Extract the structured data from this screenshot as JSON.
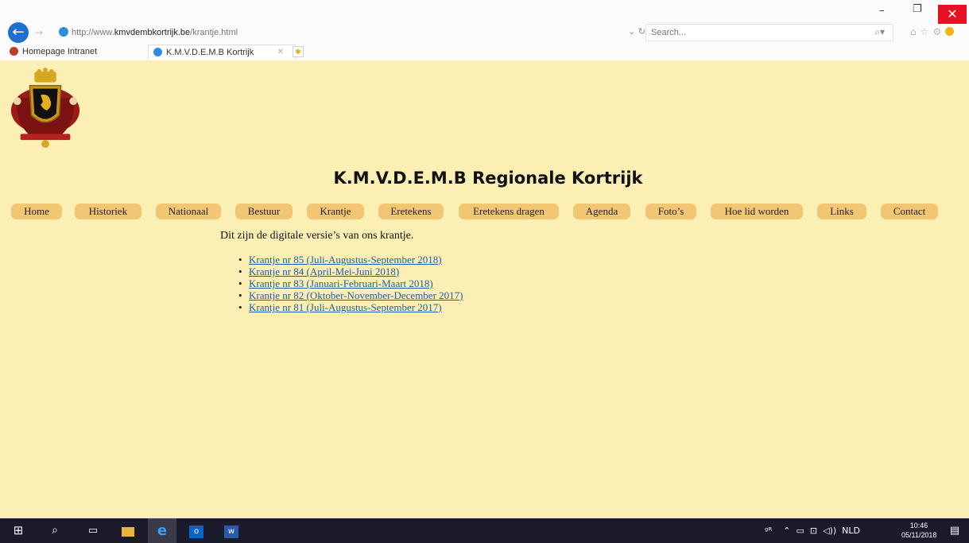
{
  "browser": {
    "address_prefix": "http://www.",
    "address_domain": "kmvdembkortrijk.be",
    "address_path": "/krantje.html",
    "search_placeholder": "Search...",
    "favorites": [
      {
        "label": "Homepage Intranet",
        "icon": "homepage-icon",
        "color": "#c0392b"
      }
    ],
    "tab": {
      "label": "K.M.V.D.E.M.B Kortrijk",
      "icon": "ie-icon"
    },
    "window_controls": {
      "minimize": "–",
      "restore": "❐",
      "close": "✕"
    }
  },
  "page": {
    "background": "#fcefb4",
    "logo": "belgian-coat-of-arms",
    "title": "K.M.V.D.E.M.B Regionale Kortrijk",
    "nav": [
      {
        "label": "Home"
      },
      {
        "label": "Historiek"
      },
      {
        "label": "Nationaal"
      },
      {
        "label": "Bestuur"
      },
      {
        "label": "Krantje"
      },
      {
        "label": "Eretekens"
      },
      {
        "label": "Eretekens dragen"
      },
      {
        "label": "Agenda"
      },
      {
        "label": "Foto’s"
      },
      {
        "label": "Hoe lid worden"
      },
      {
        "label": "Links"
      },
      {
        "label": "Contact"
      }
    ],
    "nav_color": "#f2c673",
    "intro": "Dit zijn de digitale versie’s van ons krantje.",
    "issues": [
      {
        "label": "Krantje nr 85 (Juli-Augustus-September 2018)"
      },
      {
        "label": "Krantje nr 84 (April-Mei-Juni 2018)"
      },
      {
        "label": "Krantje nr 83 (Januari-Februari-Maart 2018)"
      },
      {
        "label": "Krantje nr 82 (Oktober-November-December 2017)"
      },
      {
        "label": "Krantje nr 81 (Juli-Augustus-September 2017)"
      }
    ],
    "link_color": "#1f5fa3"
  },
  "taskbar": {
    "apps": [
      "windows-start-icon",
      "search-icon",
      "task-view-icon",
      "file-explorer-icon",
      "internet-explorer-icon",
      "outlook-icon",
      "word-icon"
    ],
    "language": "NLD",
    "time": "10:46",
    "date": "05/11/2018"
  }
}
